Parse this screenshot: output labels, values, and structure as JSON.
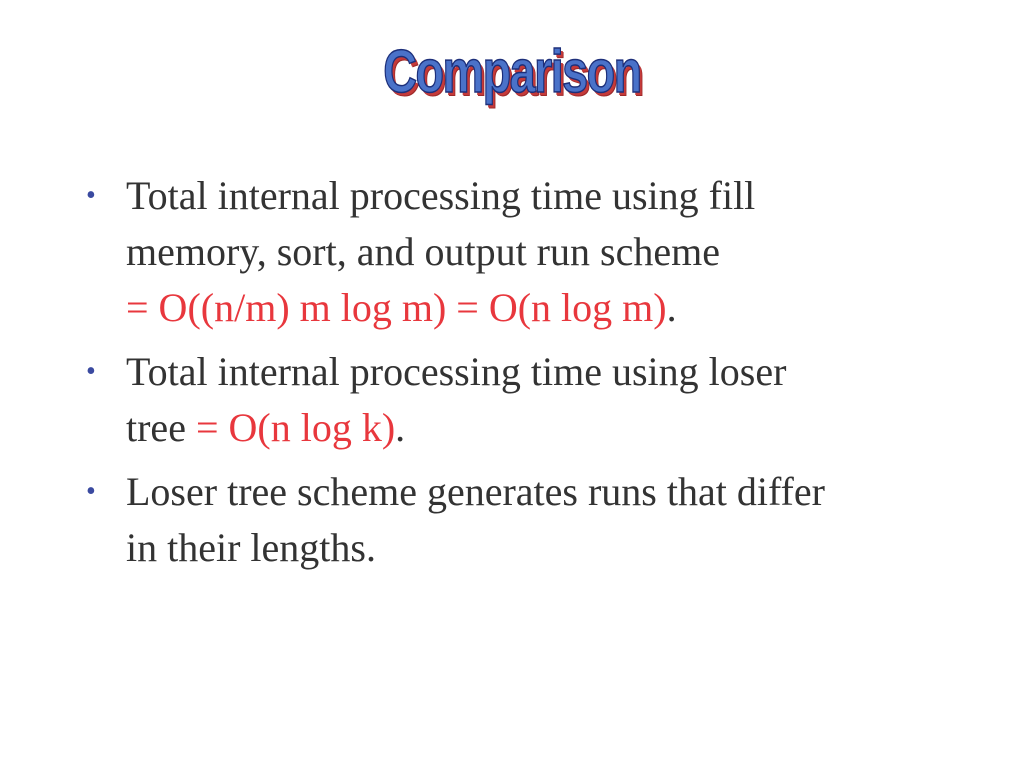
{
  "slide": {
    "title": "Comparison",
    "bullets": [
      {
        "marker": "•",
        "line1": "Total internal processing time using fill",
        "line2": "memory, sort, and output run scheme",
        "formula": "= O((n/m) m log m) = O(n log m)",
        "end": "."
      },
      {
        "marker": "•",
        "line1": "Total internal processing time using loser",
        "prefix": "tree ",
        "formula": "= O(n log k)",
        "end": "."
      },
      {
        "marker": "•",
        "line1": "Loser tree scheme generates runs that differ",
        "line2": "in their lengths."
      }
    ]
  },
  "colors": {
    "title_fill": "#4a72c9",
    "title_shadow": "#c53a3a",
    "bullet_marker": "#3a4aa0",
    "body_text": "#333333",
    "formula_text": "#e8373d"
  }
}
